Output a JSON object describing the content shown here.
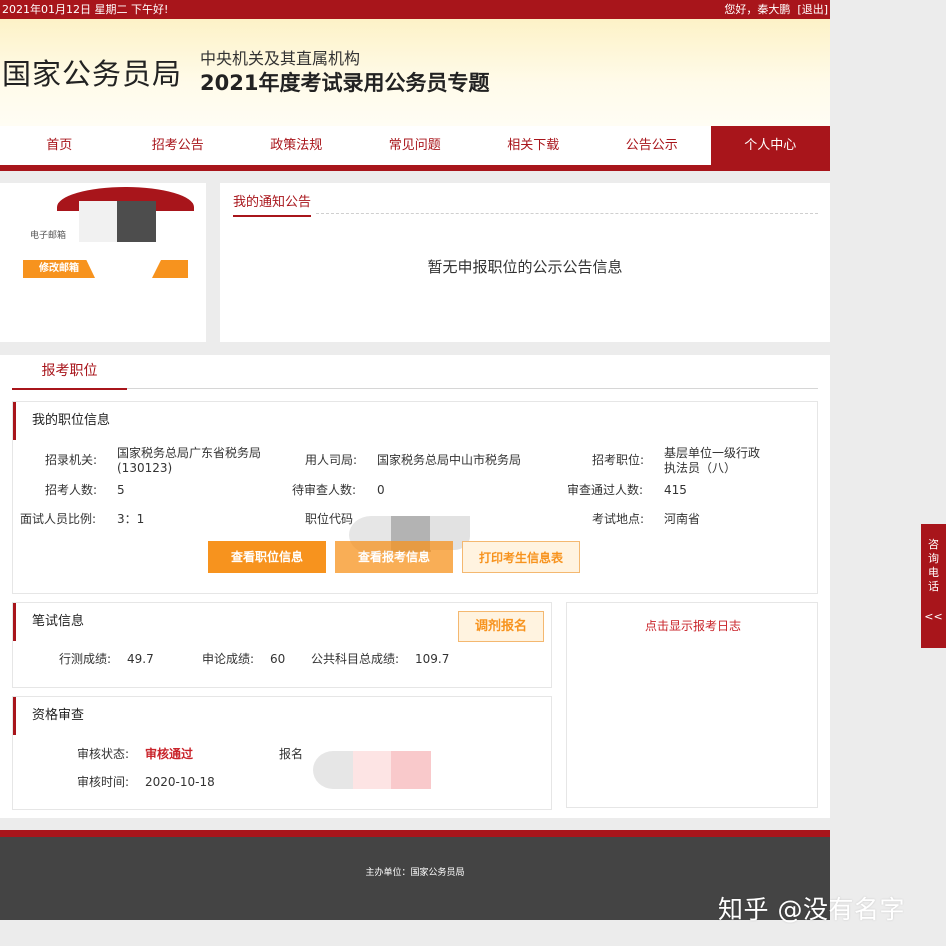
{
  "topbar": {
    "date_text": "2021年01月12日   星期二   下午好!",
    "greeting": "您好，秦大鹏",
    "logout": "[退出]"
  },
  "header": {
    "logo": "国家公务员局",
    "subtitle": "中央机关及其直属机构",
    "title": "2021年度考试录用公务员专题"
  },
  "nav": {
    "items": [
      "首页",
      "招考公告",
      "政策法规",
      "常见问题",
      "相关下载",
      "公告公示",
      "个人中心"
    ],
    "active": "个人中心"
  },
  "profile": {
    "email_label": "电子邮箱",
    "modify_email_button": "修改邮箱"
  },
  "notice": {
    "tab": "我的通知公告",
    "empty_message": "暂无申报职位的公示公告信息"
  },
  "registration": {
    "tab": "报考职位",
    "position_info": {
      "title": "我的职位信息",
      "recruiting_org_label": "招录机关:",
      "recruiting_org_value": "国家税务总局广东省税务局",
      "recruiting_org_code": "(130123)",
      "employing_dept_label": "用人司局:",
      "employing_dept_value": "国家税务总局中山市税务局",
      "position_label": "招考职位:",
      "position_value_line1": "基层单位一级行政",
      "position_value_line2": "执法员（八）",
      "quota_label": "招考人数:",
      "quota_value": "5",
      "pending_label": "待审查人数:",
      "pending_value": "0",
      "passed_label": "审查通过人数:",
      "passed_value": "415",
      "interview_ratio_label": "面试人员比例:",
      "interview_ratio_value": "3：1",
      "position_code_label": "职位代码",
      "exam_location_label": "考试地点:",
      "exam_location_value": "河南省",
      "view_position_button": "查看职位信息",
      "view_application_button": "查看报考信息",
      "print_button": "打印考生信息表"
    },
    "written_exam": {
      "title": "笔试信息",
      "adjust_button": "调剂报名",
      "xingce_label": "行测成绩:",
      "xingce_value": "49.7",
      "shenlun_label": "申论成绩:",
      "shenlun_value": "60",
      "total_label": "公共科目总成绩:",
      "total_value": "109.7"
    },
    "qualification": {
      "title": "资格审查",
      "status_label": "审核状态:",
      "status_value": "审核通过",
      "reg_no_label": "报名",
      "time_label": "审核时间:",
      "time_value": "2020-10-18"
    },
    "log": {
      "link": "点击显示报考日志"
    }
  },
  "footer": {
    "host": "主办单位：国家公务员局"
  },
  "side_tab": {
    "label": "咨询电话",
    "arrow": "<<"
  },
  "watermark": "知乎 @没有名字",
  "colors": {
    "brand_red": "#a8151b",
    "accent_orange": "#f7931e",
    "footer_grey": "#444444"
  }
}
